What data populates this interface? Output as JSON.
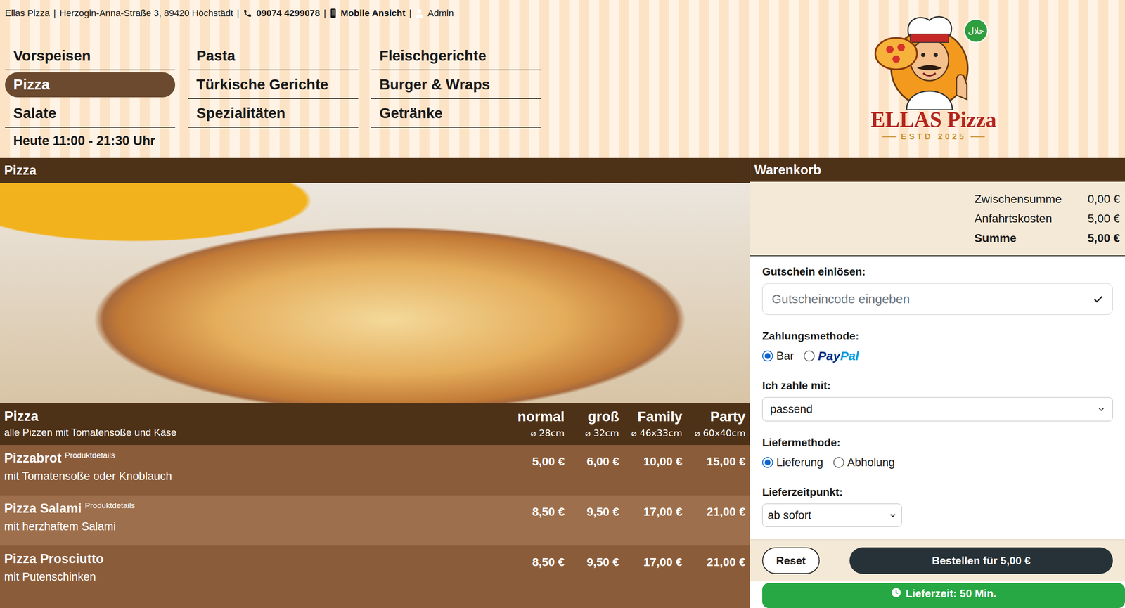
{
  "top_bar": {
    "separator": "|",
    "items": [
      {
        "text": "Ellas Pizza",
        "bold": false,
        "kind": "text"
      },
      {
        "text": "Herzogin-Anna-Straße 3, 89420 Höchstädt",
        "bold": false,
        "kind": "text"
      },
      {
        "text": "09074 4299078",
        "bold": true,
        "kind": "phone"
      },
      {
        "text": "Mobile Ansicht",
        "bold": true,
        "kind": "mobile"
      },
      {
        "text": "Admin",
        "bold": false,
        "kind": "admin"
      }
    ]
  },
  "nav": {
    "items": [
      {
        "label": "Vorspeisen",
        "selected": false
      },
      {
        "label": "Pasta",
        "selected": false
      },
      {
        "label": "Fleischgerichte",
        "selected": false
      },
      {
        "label": "Pizza",
        "selected": true
      },
      {
        "label": "Türkische Gerichte",
        "selected": false
      },
      {
        "label": "Burger & Wraps",
        "selected": false
      },
      {
        "label": "Salate",
        "selected": false
      },
      {
        "label": "Spezialitäten",
        "selected": false
      },
      {
        "label": "Getränke",
        "selected": false
      }
    ],
    "hours": "Heute 11:00 - 21:30 Uhr"
  },
  "logo": {
    "brand": "ELLAS Pizza",
    "established": "ESTD 2025",
    "halal_badge": "حلال"
  },
  "category": {
    "title": "Pizza"
  },
  "menu": {
    "title": "Pizza",
    "subtitle": "alle Pizzen mit Tomatensoße und Käse",
    "columns": [
      {
        "label": "normal",
        "size": "⌀ 28cm"
      },
      {
        "label": "groß",
        "size": "⌀ 32cm"
      },
      {
        "label": "Family",
        "size": "⌀ 46x33cm"
      },
      {
        "label": "Party",
        "size": "⌀ 60x40cm"
      }
    ],
    "rows": [
      {
        "name": "Pizzabrot",
        "details": "Produktdetails",
        "description": "mit Tomatensoße oder Knoblauch",
        "prices": [
          "5,00 €",
          "6,00 €",
          "10,00 €",
          "15,00 €"
        ]
      },
      {
        "name": "Pizza Salami",
        "details": "Produktdetails",
        "description": "mit herzhaftem Salami",
        "prices": [
          "8,50 €",
          "9,50 €",
          "17,00 €",
          "21,00 €"
        ]
      },
      {
        "name": "Pizza Prosciutto",
        "description": "mit Putenschinken",
        "prices": [
          "8,50 €",
          "9,50 €",
          "17,00 €",
          "21,00 €"
        ]
      }
    ]
  },
  "cart": {
    "title": "Warenkorb",
    "totals": [
      {
        "label": "Zwischensumme",
        "value": "0,00 €",
        "bold": false
      },
      {
        "label": "Anfahrtskosten",
        "value": "5,00 €",
        "bold": false
      },
      {
        "label": "Summe",
        "value": "5,00 €",
        "bold": true
      }
    ],
    "voucher": {
      "label": "Gutschein einlösen:",
      "placeholder": "Gutscheincode eingeben"
    },
    "payment": {
      "label": "Zahlungsmethode:",
      "options": [
        {
          "label": "Bar",
          "selected": true,
          "kind": "text"
        },
        {
          "label": [
            "Pay",
            "Pal"
          ],
          "selected": false,
          "kind": "logo"
        }
      ]
    },
    "pay_with": {
      "label": "Ich zahle mit:",
      "value": "passend"
    },
    "delivery": {
      "label": "Liefermethode:",
      "options": [
        {
          "label": "Lieferung",
          "selected": true,
          "kind": "text"
        },
        {
          "label": "Abholung",
          "selected": false,
          "kind": "text"
        }
      ]
    },
    "time": {
      "label": "Lieferzeitpunkt:",
      "value": "ab sofort"
    },
    "reset": "Reset",
    "order": "Bestellen für 5,00 €",
    "delivery_time": "Lieferzeit: 50 Min."
  }
}
